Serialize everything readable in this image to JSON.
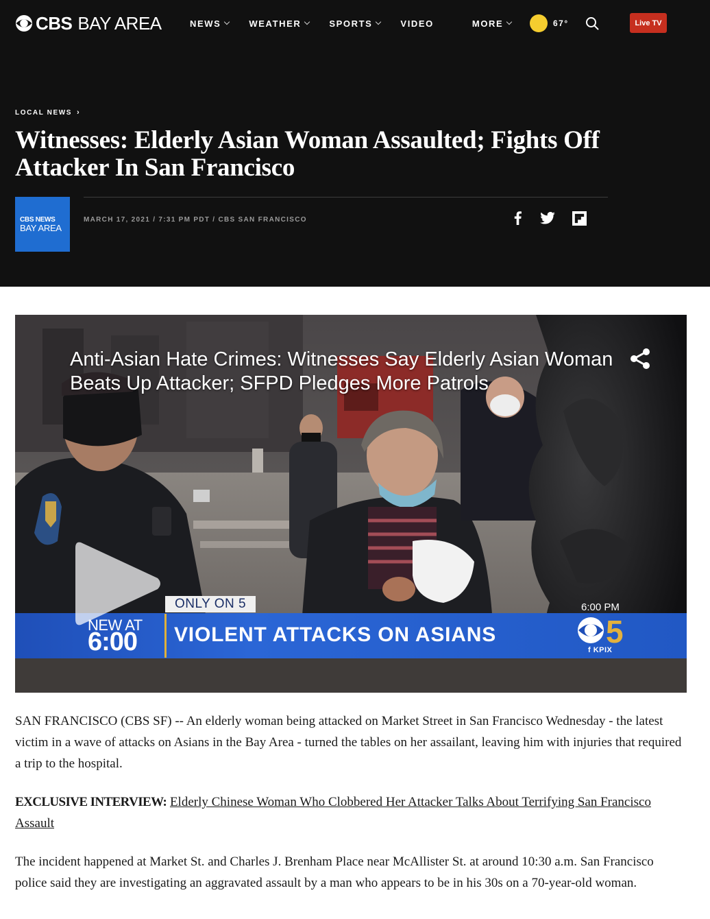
{
  "header": {
    "logo_brand": "CBS",
    "logo_region": "BAY AREA",
    "nav": [
      {
        "label": "NEWS",
        "has_dropdown": true
      },
      {
        "label": "WEATHER",
        "has_dropdown": true
      },
      {
        "label": "SPORTS",
        "has_dropdown": true
      },
      {
        "label": "VIDEO",
        "has_dropdown": false
      },
      {
        "label": "MORE",
        "has_dropdown": true
      }
    ],
    "weather": {
      "temp": "67°",
      "icon": "sun-icon",
      "icon_color": "#f5cd2f"
    },
    "search_icon": "search-icon",
    "live_tv_label": "Live TV",
    "live_tv_color": "#c62f1f"
  },
  "article_header": {
    "breadcrumb": "LOCAL NEWS",
    "headline": "Witnesses: Elderly Asian Woman Assaulted; Fights Off Attacker In San Francisco",
    "station_logo_line1": "CBS NEWS",
    "station_logo_line2": "BAY AREA",
    "station_logo_color": "#1f6dd1",
    "byline": "MARCH 17, 2021 / 7:31 PM PDT / CBS SAN FRANCISCO",
    "social_icons": [
      "facebook-icon",
      "twitter-icon",
      "flipboard-icon"
    ]
  },
  "video": {
    "title": "Anti-Asian Hate Crimes: Witnesses Say Elderly Asian Woman Beats Up Attacker; SFPD Pledges More Patrols",
    "share_icon": "share-icon",
    "play_icon": "play-icon",
    "lower_third": {
      "tag": "ONLY ON 5",
      "new_at": "NEW AT",
      "new_time": "6:00",
      "headline": "VIOLENT ATTACKS ON ASIANS",
      "clock": "6:00 PM",
      "station_number": "5",
      "station_sub": "f KPIX"
    }
  },
  "article": {
    "p1": "SAN FRANCISCO (CBS SF) -- An elderly woman being attacked on Market Street in San Francisco Wednesday - the latest victim in a wave of attacks on Asians in the Bay Area - turned the tables on her assailant, leaving him with injuries that required a trip to the hospital.",
    "exclusive_label": "EXCLUSIVE INTERVIEW:",
    "exclusive_link": "Elderly Chinese Woman Who Clobbered Her Attacker Talks About Terrifying San Francisco Assault",
    "p3": "The incident happened at Market St. and Charles J. Brenham Place near McAllister St. at around 10:30 a.m. San Francisco police said they are investigating an aggravated assault by a man who appears to be in his 30s on a 70-year-old woman."
  }
}
